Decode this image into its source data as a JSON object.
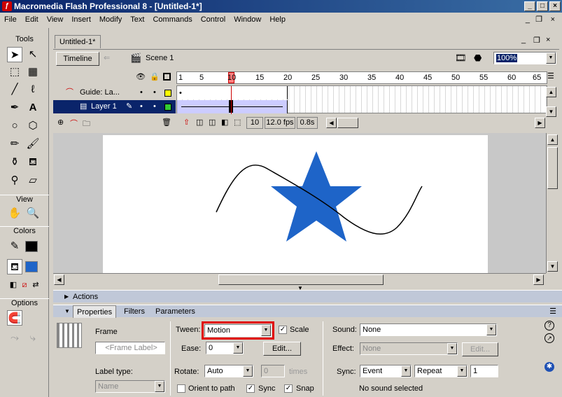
{
  "window": {
    "title": "Macromedia Flash Professional 8 - [Untitled-1*]"
  },
  "menu": [
    "File",
    "Edit",
    "View",
    "Insert",
    "Modify",
    "Text",
    "Commands",
    "Control",
    "Window",
    "Help"
  ],
  "tools": {
    "title": "Tools",
    "view": "View",
    "colors": "Colors",
    "options": "Options",
    "stroke_color": "#000000",
    "fill_color": "#1e64c8"
  },
  "document": {
    "tab": "Untitled-1*",
    "timeline_button": "Timeline",
    "scene": "Scene 1",
    "zoom": "100%"
  },
  "timeline": {
    "ruler": [
      "1",
      "5",
      "10",
      "15",
      "20",
      "25",
      "30",
      "35",
      "40",
      "45",
      "50",
      "55",
      "60",
      "65"
    ],
    "layers": [
      {
        "name": "Guide: La..."
      },
      {
        "name": "Layer 1"
      }
    ],
    "current_frame": "10",
    "fps": "12.0 fps",
    "time": "0.8s"
  },
  "stage": {
    "star_color": "#1e64c8"
  },
  "panels": {
    "actions": "Actions",
    "tabs": [
      "Properties",
      "Filters",
      "Parameters"
    ]
  },
  "props": {
    "frame_label_title": "Frame",
    "frame_label_placeholder": "<Frame Label>",
    "label_type_title": "Label type:",
    "label_type_value": "Name",
    "tween_label": "Tween:",
    "tween_value": "Motion",
    "scale_label": "Scale",
    "ease_label": "Ease:",
    "ease_value": "0",
    "edit_label": "Edit...",
    "rotate_label": "Rotate:",
    "rotate_value": "Auto",
    "times_value": "0",
    "times_label": "times",
    "orient_label": "Orient to path",
    "sync_label": "Sync",
    "snap_label": "Snap",
    "sound_label": "Sound:",
    "sound_value": "None",
    "effect_label": "Effect:",
    "effect_value": "None",
    "effect_edit": "Edit...",
    "sync2_label": "Sync:",
    "sync2_value": "Event",
    "repeat_value": "Repeat",
    "repeat_count": "1",
    "no_sound": "No sound selected"
  }
}
